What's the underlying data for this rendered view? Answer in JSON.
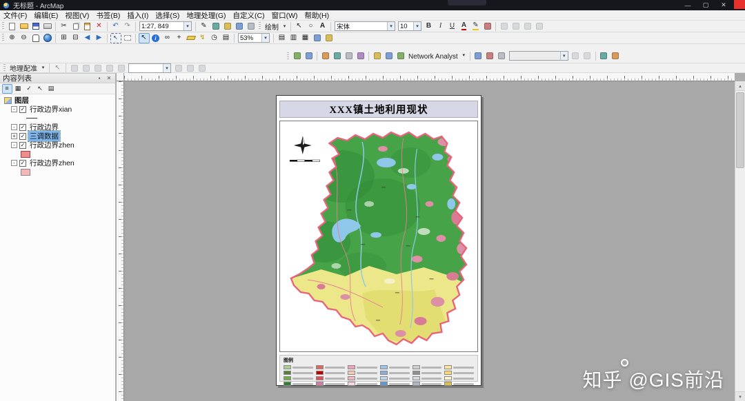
{
  "window": {
    "title": "无标题 - ArcMap"
  },
  "menu": {
    "items": [
      "文件(F)",
      "编辑(E)",
      "视图(V)",
      "书签(B)",
      "插入(I)",
      "选择(S)",
      "地理处理(G)",
      "自定义(C)",
      "窗口(W)",
      "帮助(H)"
    ]
  },
  "icons": {
    "minimize": "—",
    "maximize": "▢",
    "close": "✕",
    "cut": "✂",
    "delete": "✕",
    "undo": "↶",
    "redo": "↷",
    "zoom_in": "⊕",
    "zoom_out": "⊖",
    "fixed_zoom_in": "⊞",
    "fixed_zoom_out": "⊟",
    "back": "◀",
    "forward": "▶",
    "select": "↖",
    "identify": "i",
    "find": "∞",
    "hyperlink": "↯",
    "clock": "◷",
    "go_to_xy": "+",
    "chevron": "▾",
    "arrow_up": "▴",
    "arrow_down": "▾",
    "text_tool": "A",
    "ellipse_tool": "○",
    "pencil": "✎",
    "list": "≡",
    "pin": "▪",
    "check": "✓",
    "collapse": "-",
    "expand": "+",
    "page": "▤",
    "grid": "▦",
    "columns": "▥"
  },
  "toolbars": {
    "scale_combo": "1:27, 849",
    "draw_label": "绘制",
    "font_combo": "宋体",
    "font_size_combo": "10",
    "bold": "B",
    "italic": "I",
    "underline": "U",
    "font_color": "A",
    "zoom_combo": "53%",
    "network_analyst_label": "Network Analyst",
    "na_combo": "",
    "georef_label": "地理配准",
    "georef_combo": ""
  },
  "toc": {
    "title": "内容列表",
    "root_label": "图层",
    "layers": [
      {
        "label": "行政边界xian",
        "checked": true
      },
      {
        "label": "行政边界",
        "checked": true
      },
      {
        "label": "三调数据",
        "checked": true,
        "selected": true
      },
      {
        "label": "行政边界zhen",
        "checked": true,
        "swatch": "#ef8b8b"
      },
      {
        "label": "行政边界zhen",
        "checked": true,
        "swatch": "#f5b8b8"
      }
    ]
  },
  "layout_page": {
    "title": "XXX镇土地利用现状",
    "legend_title": "图例",
    "legend_colors": [
      "#a9d18e",
      "#e06666",
      "#f2a2b8",
      "#9dc3e6",
      "#cfcfcf",
      "#ffe699",
      "#548235",
      "#c00000",
      "#f8cbad",
      "#8faadc",
      "#8f8f8f",
      "#ffd966",
      "#70ad47",
      "#e84a5f",
      "#f4b8c4",
      "#bdd7ee",
      "#d6dce5",
      "#fff2cc",
      "#2e7d32",
      "#d97ba1",
      "#f6d9e0",
      "#5b9bd5",
      "#aeb8c4",
      "#e2c044"
    ],
    "map_palette": {
      "base_green": "#46a347",
      "dark_green": "#2f8a36",
      "yellow": "#ece789",
      "pink": "#dd8fa5",
      "water_blue": "#8ec7ea",
      "boundary_pink": "#e8647c"
    }
  },
  "watermark": {
    "text": "知乎 @GIS前沿"
  }
}
